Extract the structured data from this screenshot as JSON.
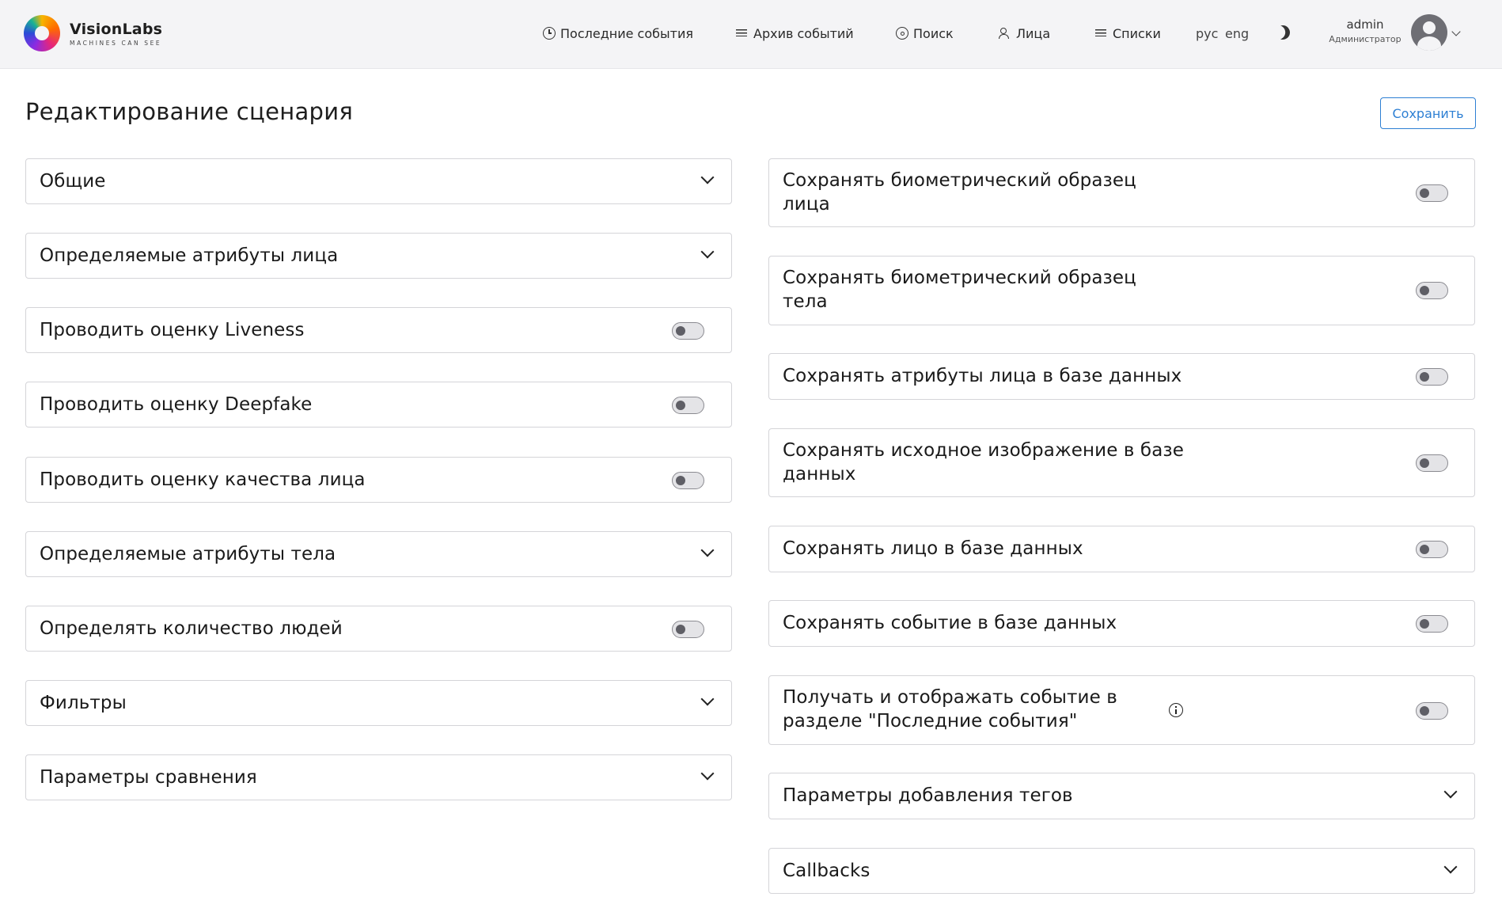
{
  "brand": {
    "name": "VisionLabs",
    "tagline": "MACHINES CAN SEE"
  },
  "nav": {
    "recent_events": "Последние события",
    "event_archive": "Архив событий",
    "search": "Поиск",
    "faces": "Лица",
    "lists": "Списки"
  },
  "lang": {
    "ru": "рус",
    "en": "eng"
  },
  "user": {
    "name": "admin",
    "role": "Администратор"
  },
  "page": {
    "title": "Редактирование сценария",
    "save_label": "Сохранить"
  },
  "left": [
    {
      "label": "Общие",
      "kind": "expand"
    },
    {
      "label": "Определяемые атрибуты лица",
      "kind": "expand"
    },
    {
      "label": "Проводить оценку Liveness",
      "kind": "toggle",
      "on": false
    },
    {
      "label": "Проводить оценку Deepfake",
      "kind": "toggle",
      "on": false
    },
    {
      "label": "Проводить оценку качества лица",
      "kind": "toggle",
      "on": false
    },
    {
      "label": "Определяемые атрибуты тела",
      "kind": "expand"
    },
    {
      "label": "Определять количество людей",
      "kind": "toggle",
      "on": false
    },
    {
      "label": "Фильтры",
      "kind": "expand"
    },
    {
      "label": "Параметры сравнения",
      "kind": "expand"
    }
  ],
  "right": [
    {
      "label_line1": "Сохранять биометрический образец",
      "label_line2": "лица",
      "kind": "toggle",
      "on": false
    },
    {
      "label_line1": "Сохранять биометрический образец",
      "label_line2": "тела",
      "kind": "toggle",
      "on": false
    },
    {
      "label_line1": "Сохранять атрибуты лица в базе данных",
      "label_line2": "",
      "kind": "toggle",
      "on": false
    },
    {
      "label_line1": "Сохранять исходное изображение в базе",
      "label_line2": "данных",
      "kind": "toggle",
      "on": false
    },
    {
      "label_line1": "Сохранять лицо в базе данных",
      "label_line2": "",
      "kind": "toggle",
      "on": false
    },
    {
      "label_line1": "Сохранять событие в базе данных",
      "label_line2": "",
      "kind": "toggle",
      "on": false
    },
    {
      "label_line1": "Получать и отображать событие в",
      "label_line2": "разделе \"Последние события\"",
      "kind": "toggle",
      "on": false,
      "info": true
    },
    {
      "label_line1": "Параметры добавления тегов",
      "label_line2": "",
      "kind": "expand"
    },
    {
      "label_line1": "Callbacks",
      "label_line2": "",
      "kind": "expand"
    }
  ]
}
